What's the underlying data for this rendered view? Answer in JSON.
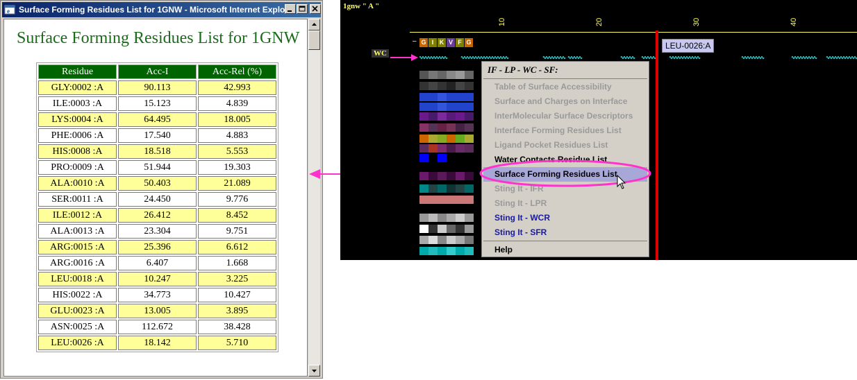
{
  "browser": {
    "title": "Surface Forming Residues List for 1GNW - Microsoft Internet Explo...",
    "heading": "Surface Forming Residues List for 1GNW"
  },
  "table": {
    "headers": [
      "Residue",
      "Acc-I",
      "Acc-Rel (%)"
    ],
    "rows": [
      [
        "GLY:0002 :A",
        "90.113",
        "42.993"
      ],
      [
        "ILE:0003 :A",
        "15.123",
        "4.839"
      ],
      [
        "LYS:0004 :A",
        "64.495",
        "18.005"
      ],
      [
        "PHE:0006 :A",
        "17.540",
        "4.883"
      ],
      [
        "HIS:0008 :A",
        "18.518",
        "5.553"
      ],
      [
        "PRO:0009 :A",
        "51.944",
        "19.303"
      ],
      [
        "ALA:0010 :A",
        "50.403",
        "21.089"
      ],
      [
        "SER:0011 :A",
        "24.450",
        "9.776"
      ],
      [
        "ILE:0012 :A",
        "26.412",
        "8.452"
      ],
      [
        "ALA:0013 :A",
        "23.304",
        "9.751"
      ],
      [
        "ARG:0015 :A",
        "25.396",
        "6.612"
      ],
      [
        "ARG:0016 :A",
        "6.407",
        "1.668"
      ],
      [
        "LEU:0018 :A",
        "10.247",
        "3.225"
      ],
      [
        "HIS:0022 :A",
        "34.773",
        "10.427"
      ],
      [
        "GLU:0023 :A",
        "13.005",
        "3.895"
      ],
      [
        "ASN:0025 :A",
        "112.672",
        "38.428"
      ],
      [
        "LEU:0026 :A",
        "18.142",
        "5.710"
      ]
    ]
  },
  "viewer": {
    "chain_label": "1gnw \" A \"",
    "ruler_ticks": [
      "10",
      "20",
      "30",
      "40"
    ],
    "sequence": [
      "G",
      "I",
      "K",
      "V",
      "F",
      "G"
    ],
    "sequence_colors": [
      "#c86400",
      "#808000",
      "#808000",
      "#6a3d9a",
      "#808000",
      "#c86400"
    ],
    "track_label": "WC",
    "tooltip": "LEU-0026:A",
    "menu": {
      "header": "IF - LP - WC - SF:",
      "items": [
        {
          "label": "Table of Surface Accessibility",
          "state": "disabled"
        },
        {
          "label": "Surface and Charges on Interface",
          "state": "disabled"
        },
        {
          "label": "InterMolecular Surface Descriptors",
          "state": "disabled"
        },
        {
          "label": "Interface Forming Residues List",
          "state": "disabled"
        },
        {
          "label": "Ligand Pocket Residues List",
          "state": "disabled"
        },
        {
          "label": "Water Contacts Residue List",
          "state": "enabled"
        },
        {
          "label": "Surface Forming Residues List",
          "state": "selected"
        },
        {
          "label": "Sting It - IFR",
          "state": "disabled"
        },
        {
          "label": "Sting It - LPR",
          "state": "disabled"
        },
        {
          "label": "Sting It - WCR",
          "state": "blue"
        },
        {
          "label": "Sting It - SFR",
          "state": "blue"
        }
      ],
      "help": "Help"
    },
    "colors": {
      "accent": "#ff33cc",
      "ruler": "#ffff66",
      "marker": "#e00000"
    }
  }
}
